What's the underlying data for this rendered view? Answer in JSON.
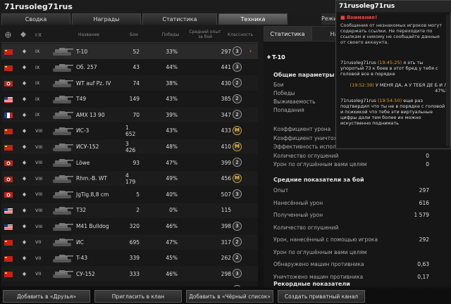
{
  "window": {
    "title": "71rusoleg71rus"
  },
  "tabs": [
    {
      "label": "Сводка",
      "active": false
    },
    {
      "label": "Награды",
      "active": false
    },
    {
      "label": "Статистика",
      "active": false
    },
    {
      "label": "Техника",
      "active": true
    },
    {
      "label": "Режи",
      "active": false
    }
  ],
  "table": {
    "headers": {
      "name": "Название",
      "battles": "Бои",
      "wins": "Победы",
      "avg_xp": "Средний опыт за бой",
      "mastery": "Классность"
    },
    "rows": [
      {
        "tier": "IX",
        "name": "T-10",
        "battles": "52",
        "wins": "33%",
        "xp": "297",
        "mark": "3",
        "flag": "ussr",
        "selected": true
      },
      {
        "tier": "IX",
        "name": "Об. 257",
        "battles": "43",
        "wins": "44%",
        "xp": "441",
        "mark": "3",
        "flag": "ussr"
      },
      {
        "tier": "IX",
        "name": "WT auf Pz. IV",
        "battles": "74",
        "wins": "38%",
        "xp": "430",
        "mark": "2",
        "flag": "ger"
      },
      {
        "tier": "IX",
        "name": "T49",
        "battles": "149",
        "wins": "43%",
        "xp": "385",
        "mark": "2",
        "flag": "usa"
      },
      {
        "tier": "IX",
        "name": "AMX 13 90",
        "battles": "70",
        "wins": "39%",
        "xp": "347",
        "mark": "2",
        "flag": "fra"
      },
      {
        "tier": "VIII",
        "name": "ИС-3",
        "battles": "1 652",
        "wins": "43%",
        "xp": "433",
        "mark": "M",
        "flag": "ussr"
      },
      {
        "tier": "VIII",
        "name": "ИСУ-152",
        "battles": "3 426",
        "wins": "48%",
        "xp": "410",
        "mark": "M",
        "flag": "ussr"
      },
      {
        "tier": "VIII",
        "name": "Löwe",
        "battles": "93",
        "wins": "47%",
        "xp": "399",
        "mark": "2",
        "flag": "ger"
      },
      {
        "tier": "VIII",
        "name": "Rhm.-B. WT",
        "battles": "4 179",
        "wins": "49%",
        "xp": "456",
        "mark": "M",
        "flag": "ger"
      },
      {
        "tier": "VIII",
        "name": "JgTig.8,8 cm",
        "battles": "5",
        "wins": "40%",
        "xp": "507",
        "mark": "3",
        "flag": "ger"
      },
      {
        "tier": "VIII",
        "name": "T32",
        "battles": "2",
        "wins": "0%",
        "xp": "115",
        "mark": "",
        "flag": "usa"
      },
      {
        "tier": "VIII",
        "name": "M41 Bulldog",
        "battles": "320",
        "wins": "46%",
        "xp": "398",
        "mark": "3",
        "flag": "usa"
      },
      {
        "tier": "VII",
        "name": "ИС",
        "battles": "695",
        "wins": "47%",
        "xp": "317",
        "mark": "2",
        "flag": "ussr"
      },
      {
        "tier": "VII",
        "name": "T-43",
        "battles": "339",
        "wins": "45%",
        "xp": "262",
        "mark": "2",
        "flag": "ussr"
      },
      {
        "tier": "VII",
        "name": "СУ-152",
        "battles": "333",
        "wins": "46%",
        "xp": "298",
        "mark": "3",
        "flag": "ussr"
      },
      {
        "tier": "VII",
        "name": "С-51",
        "battles": "973",
        "wins": "50%",
        "xp": "356",
        "mark": "3",
        "flag": "ussr"
      }
    ]
  },
  "details": {
    "tabs": [
      "Статистика",
      "Наг"
    ],
    "tank_name": "T-10",
    "general_header": "Общие параметры",
    "general": [
      {
        "label": "Бои",
        "value": ""
      },
      {
        "label": "Победы",
        "value": ""
      },
      {
        "label": "Выживаемость",
        "value": ""
      },
      {
        "label": "Попадания",
        "value": ""
      }
    ],
    "efficiency": [
      {
        "label": "Коэффициент урона",
        "value": ""
      },
      {
        "label": "Коэффициент уничтожения",
        "value": ""
      },
      {
        "label": "Эффективность использования",
        "value": ""
      },
      {
        "label": "Количество оглушений",
        "value": "0"
      },
      {
        "label": "Урон по оглушённым вами целям",
        "value": "0"
      }
    ],
    "avg_header": "Средние показатели за бой",
    "avg": [
      {
        "label": "Опыт",
        "value": "297"
      },
      {
        "label": "Нанесённый урон",
        "value": "616"
      },
      {
        "label": "Полученный урон",
        "value": "1 579"
      },
      {
        "label": "Количество оглушений",
        "value": ""
      },
      {
        "label": "Урон, нанесённый с помощью игрока",
        "value": "292"
      },
      {
        "label": "Урон по оглушённым вами целям",
        "value": ""
      },
      {
        "label": "Обнаружено машин противника",
        "value": "0,63"
      },
      {
        "label": "Уничтожено машин противника",
        "value": "0,17"
      }
    ],
    "records_header": "Рекордные показатели"
  },
  "chat": {
    "title": "71rusoleg71rus",
    "warning_title": "Внимание!",
    "warning_text": "Сообщения от незнакомых игроков могут содержать ссылки. Не переходите по ссылкам и никому не сообщайте данные от своего аккаунта.",
    "messages": [
      {
        "author": "71rusoleg71rus",
        "time": "(19:45:25)",
        "text": "я эть ты упоротый 73 к боев в этот бред у тебя с головой все в порядке"
      },
      {
        "author": "",
        "time": "(19:52:39)",
        "text": "У МЕНЯ ДА, А У ТЕБЯ ДЕ Б И Л 47%?"
      },
      {
        "author": "71rusoleg71rus",
        "time": "(19:54:50)",
        "text": "еще раз подтвердил что ты не в порядке с головой и психикой что тебе эти виртуальные цифры дали тем более их можно искуственно поднимать"
      }
    ]
  },
  "buttons": {
    "add_friend": "Добавить в «Друзья»",
    "invite_clan": "Пригласить в клан",
    "blacklist": "Добавить в «Чёрный список»",
    "private_channel": "Создать приватный канал"
  }
}
